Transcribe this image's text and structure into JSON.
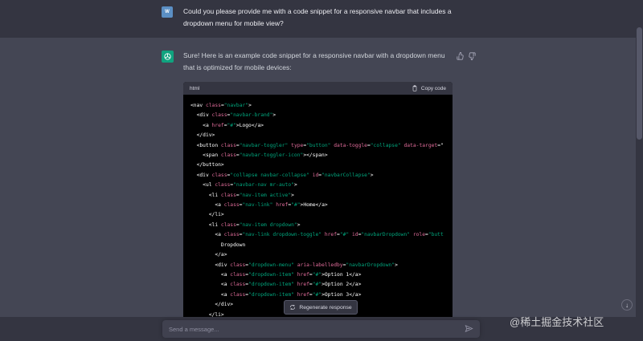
{
  "user_message": {
    "avatar_initials": "W",
    "text": "Could you please provide me with a code snippet for a responsive navbar that includes a dropdown menu for mobile view?"
  },
  "assistant_message": {
    "text": "Sure! Here is an example code snippet for a responsive navbar with a dropdown menu that is optimized for mobile devices:",
    "code_block": {
      "language": "html",
      "copy_label": "Copy code",
      "lines": [
        [
          [
            "t",
            "<nav "
          ],
          [
            "an",
            "class"
          ],
          [
            "t",
            "="
          ],
          [
            "av",
            "\"navbar\""
          ],
          [
            "t",
            ">"
          ]
        ],
        [
          [
            "t",
            "  <div "
          ],
          [
            "an",
            "class"
          ],
          [
            "t",
            "="
          ],
          [
            "av",
            "\"navbar-brand\""
          ],
          [
            "t",
            ">"
          ]
        ],
        [
          [
            "t",
            "    <a "
          ],
          [
            "an",
            "href"
          ],
          [
            "t",
            "="
          ],
          [
            "av",
            "\"#\""
          ],
          [
            "t",
            ">"
          ],
          [
            "tx",
            "Logo"
          ],
          [
            "t",
            "</a>"
          ]
        ],
        [
          [
            "t",
            "  </div>"
          ]
        ],
        [
          [
            "t",
            "  <button "
          ],
          [
            "an",
            "class"
          ],
          [
            "t",
            "="
          ],
          [
            "av",
            "\"navbar-toggler\""
          ],
          [
            "t",
            " "
          ],
          [
            "an",
            "type"
          ],
          [
            "t",
            "="
          ],
          [
            "av",
            "\"button\""
          ],
          [
            "t",
            " "
          ],
          [
            "an",
            "data-toggle"
          ],
          [
            "t",
            "="
          ],
          [
            "av",
            "\"collapse\""
          ],
          [
            "t",
            " "
          ],
          [
            "an",
            "data-target"
          ],
          [
            "t",
            "=\""
          ]
        ],
        [
          [
            "t",
            "    <span "
          ],
          [
            "an",
            "class"
          ],
          [
            "t",
            "="
          ],
          [
            "av",
            "\"navbar-toggler-icon\""
          ],
          [
            "t",
            "></span>"
          ]
        ],
        [
          [
            "t",
            "  </button>"
          ]
        ],
        [
          [
            "t",
            "  <div "
          ],
          [
            "an",
            "class"
          ],
          [
            "t",
            "="
          ],
          [
            "av",
            "\"collapse navbar-collapse\""
          ],
          [
            "t",
            " "
          ],
          [
            "an",
            "id"
          ],
          [
            "t",
            "="
          ],
          [
            "av",
            "\"navbarCollapse\""
          ],
          [
            "t",
            ">"
          ]
        ],
        [
          [
            "t",
            "    <ul "
          ],
          [
            "an",
            "class"
          ],
          [
            "t",
            "="
          ],
          [
            "av",
            "\"navbar-nav mr-auto\""
          ],
          [
            "t",
            ">"
          ]
        ],
        [
          [
            "t",
            "      <li "
          ],
          [
            "an",
            "class"
          ],
          [
            "t",
            "="
          ],
          [
            "av",
            "\"nav-item active\""
          ],
          [
            "t",
            ">"
          ]
        ],
        [
          [
            "t",
            "        <a "
          ],
          [
            "an",
            "class"
          ],
          [
            "t",
            "="
          ],
          [
            "av",
            "\"nav-link\""
          ],
          [
            "t",
            " "
          ],
          [
            "an",
            "href"
          ],
          [
            "t",
            "="
          ],
          [
            "av",
            "\"#\""
          ],
          [
            "t",
            ">"
          ],
          [
            "tx",
            "Home"
          ],
          [
            "t",
            "</a>"
          ]
        ],
        [
          [
            "t",
            "      </li>"
          ]
        ],
        [
          [
            "t",
            "      <li "
          ],
          [
            "an",
            "class"
          ],
          [
            "t",
            "="
          ],
          [
            "av",
            "\"nav-item dropdown\""
          ],
          [
            "t",
            ">"
          ]
        ],
        [
          [
            "t",
            "        <a "
          ],
          [
            "an",
            "class"
          ],
          [
            "t",
            "="
          ],
          [
            "av",
            "\"nav-link dropdown-toggle\""
          ],
          [
            "t",
            " "
          ],
          [
            "an",
            "href"
          ],
          [
            "t",
            "="
          ],
          [
            "av",
            "\"#\""
          ],
          [
            "t",
            " "
          ],
          [
            "an",
            "id"
          ],
          [
            "t",
            "="
          ],
          [
            "av",
            "\"navbarDropdown\""
          ],
          [
            "t",
            " "
          ],
          [
            "an",
            "role"
          ],
          [
            "t",
            "="
          ],
          [
            "av",
            "\"butt"
          ]
        ],
        [
          [
            "tx",
            "          Dropdown"
          ]
        ],
        [
          [
            "t",
            "        </a>"
          ]
        ],
        [
          [
            "t",
            "        <div "
          ],
          [
            "an",
            "class"
          ],
          [
            "t",
            "="
          ],
          [
            "av",
            "\"dropdown-menu\""
          ],
          [
            "t",
            " "
          ],
          [
            "an",
            "aria-labelledby"
          ],
          [
            "t",
            "="
          ],
          [
            "av",
            "\"navbarDropdown\""
          ],
          [
            "t",
            ">"
          ]
        ],
        [
          [
            "t",
            "          <a "
          ],
          [
            "an",
            "class"
          ],
          [
            "t",
            "="
          ],
          [
            "av",
            "\"dropdown-item\""
          ],
          [
            "t",
            " "
          ],
          [
            "an",
            "href"
          ],
          [
            "t",
            "="
          ],
          [
            "av",
            "\"#\""
          ],
          [
            "t",
            ">"
          ],
          [
            "tx",
            "Option 1"
          ],
          [
            "t",
            "</a>"
          ]
        ],
        [
          [
            "t",
            "          <a "
          ],
          [
            "an",
            "class"
          ],
          [
            "t",
            "="
          ],
          [
            "av",
            "\"dropdown-item\""
          ],
          [
            "t",
            " "
          ],
          [
            "an",
            "href"
          ],
          [
            "t",
            "="
          ],
          [
            "av",
            "\"#\""
          ],
          [
            "t",
            ">"
          ],
          [
            "tx",
            "Option 2"
          ],
          [
            "t",
            "</a>"
          ]
        ],
        [
          [
            "t",
            "          <a "
          ],
          [
            "an",
            "class"
          ],
          [
            "t",
            "="
          ],
          [
            "av",
            "\"dropdown-item\""
          ],
          [
            "t",
            " "
          ],
          [
            "an",
            "href"
          ],
          [
            "t",
            "="
          ],
          [
            "av",
            "\"#\""
          ],
          [
            "t",
            ">"
          ],
          [
            "tx",
            "Option 3"
          ],
          [
            "t",
            "</a>"
          ]
        ],
        [
          [
            "t",
            "        </div>"
          ]
        ],
        [
          [
            "t",
            "      </li>"
          ]
        ]
      ]
    }
  },
  "regenerate_label": "Regenerate response",
  "input": {
    "placeholder": "Send a message..."
  },
  "watermark": "@稀土掘金技术社区",
  "colors": {
    "page_bg": "#444654",
    "user_row_bg": "#343541",
    "assistant_avatar": "#10a37f",
    "code_bg": "#000000",
    "attr_name": "#e06c9a",
    "attr_value": "#00a67d"
  },
  "icons": {
    "thumbs_up": "thumbs-up-icon",
    "thumbs_down": "thumbs-down-icon",
    "clipboard": "clipboard-icon",
    "refresh": "refresh-icon",
    "send": "send-icon",
    "arrow_down": "arrow-down-icon"
  }
}
